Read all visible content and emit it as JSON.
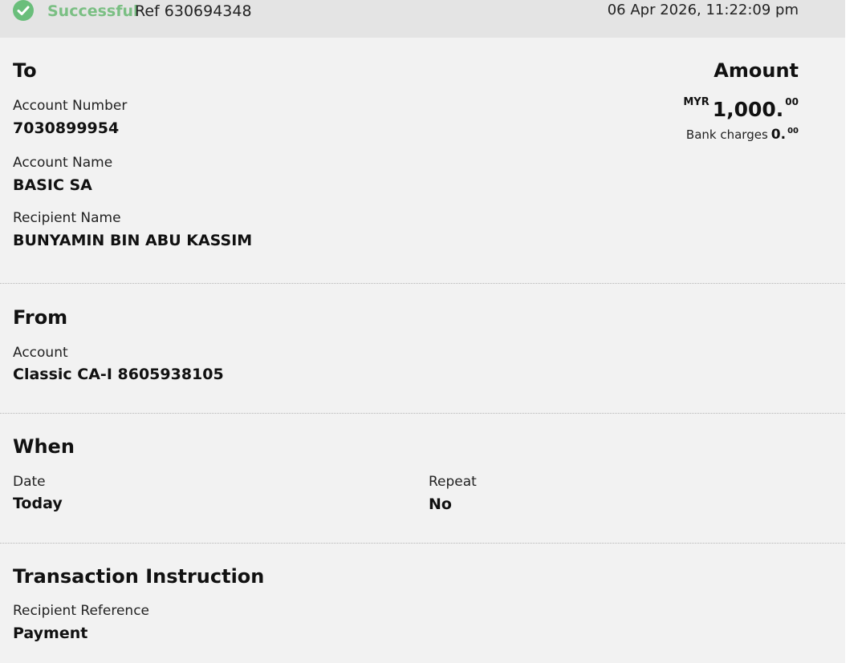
{
  "status": {
    "icon": "check-circle-icon",
    "label": "Successful",
    "reference": "Ref 630694348",
    "datetime": "06 Apr 2026, 11:22:09 pm",
    "colors": {
      "success": "#6abe7b"
    }
  },
  "to": {
    "title": "To",
    "account_number_label": "Account Number",
    "account_number": "7030899954",
    "account_name_label": "Account Name",
    "account_name": "BASIC SA",
    "recipient_name_label": "Recipient Name",
    "recipient_name": "BUNYAMIN BIN ABU KASSIM"
  },
  "amount": {
    "title": "Amount",
    "currency": "MYR",
    "value_main": "1,000.",
    "value_cents": "00",
    "bank_charges_label": "Bank charges",
    "bank_charges_main": "0.",
    "bank_charges_cents": "00"
  },
  "from": {
    "title": "From",
    "account_label": "Account",
    "account": "Classic CA-I 8605938105"
  },
  "when": {
    "title": "When",
    "date_label": "Date",
    "date": "Today",
    "repeat_label": "Repeat",
    "repeat": "No"
  },
  "instruction": {
    "title": "Transaction Instruction",
    "recipient_reference_label": "Recipient Reference",
    "recipient_reference": "Payment"
  }
}
